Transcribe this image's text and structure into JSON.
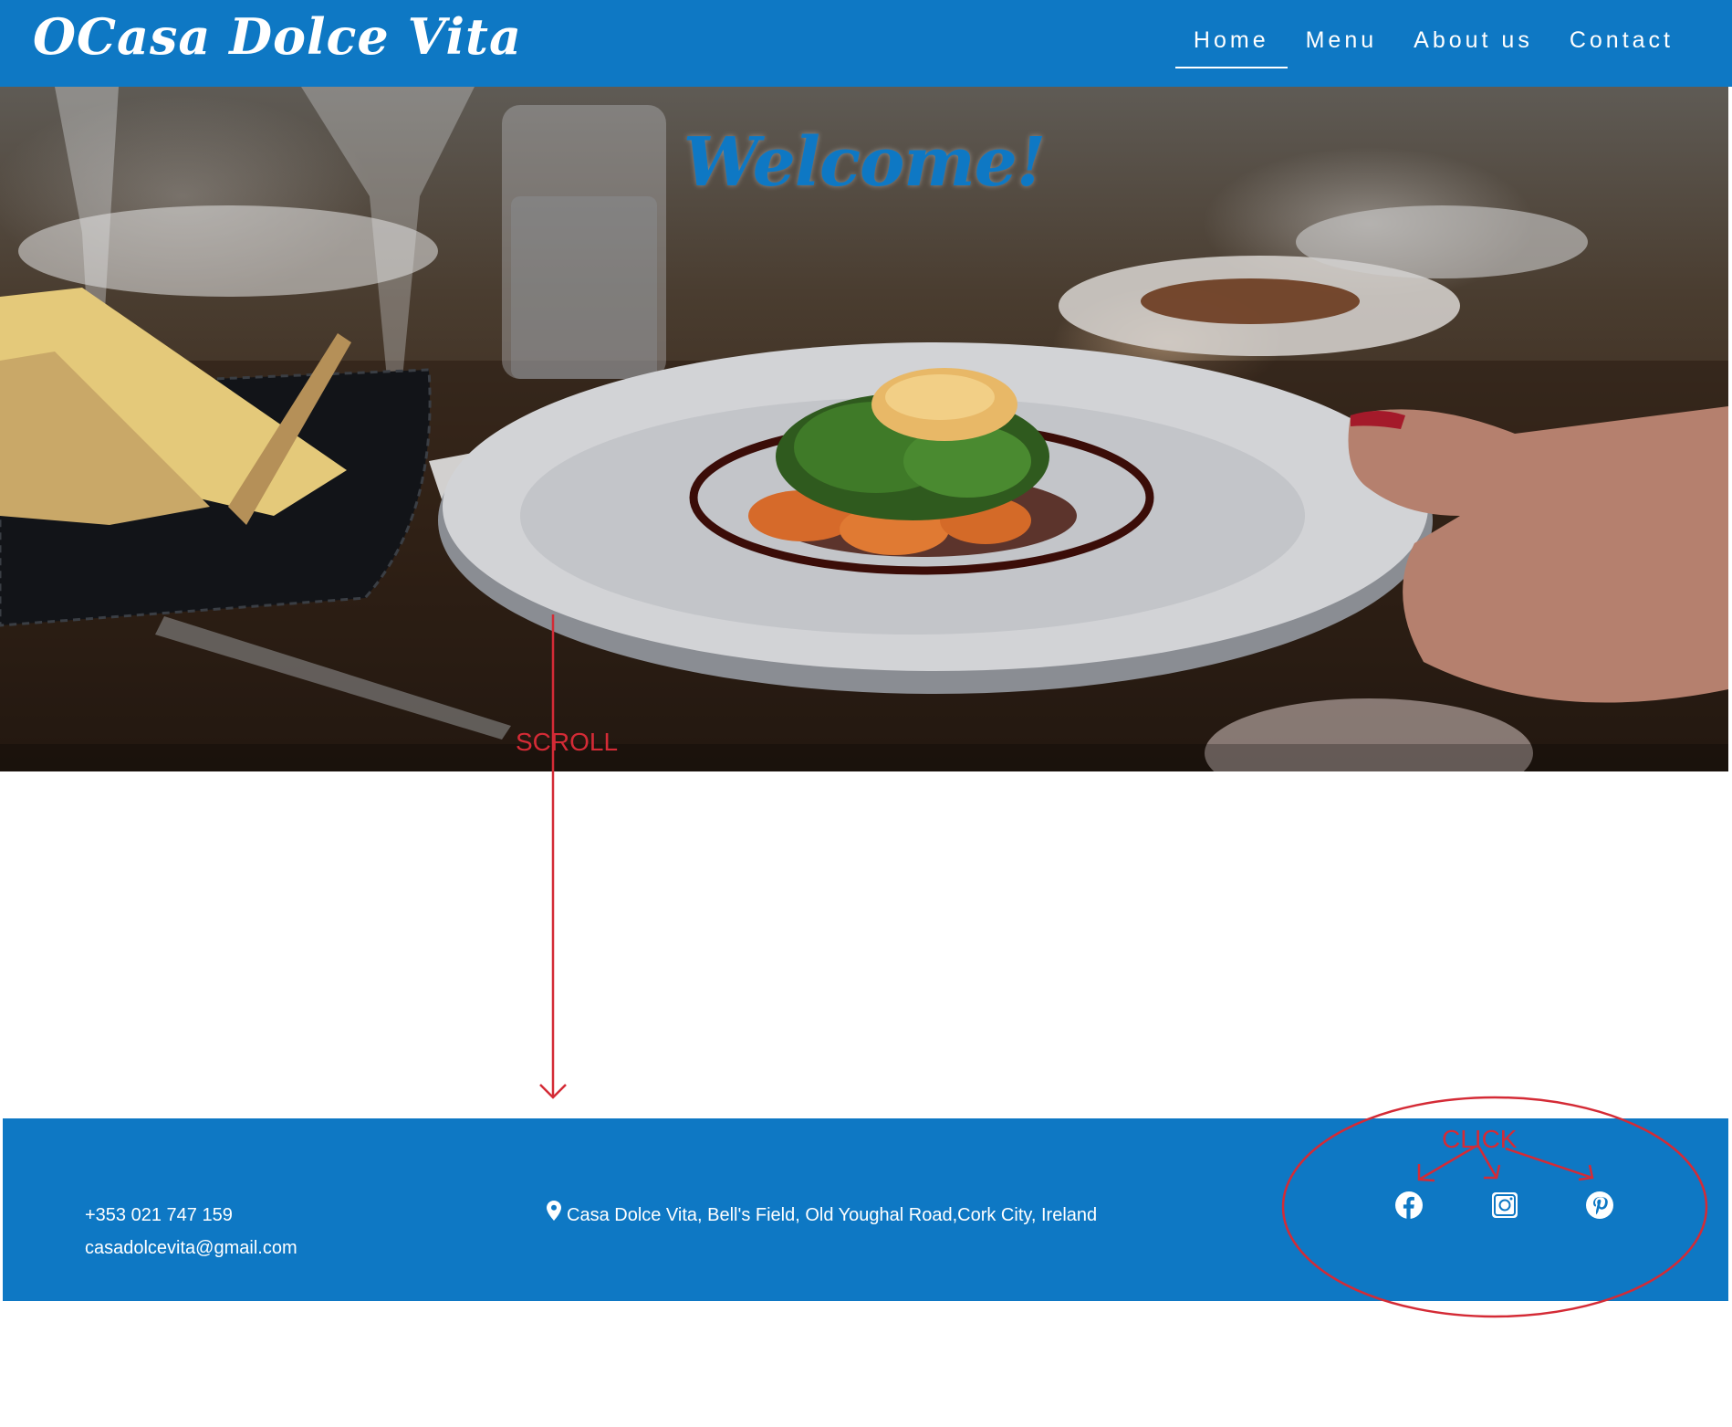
{
  "header": {
    "logo": "OCasa Dolce Vita",
    "nav": [
      {
        "label": "Home",
        "active": true
      },
      {
        "label": "Menu",
        "active": false
      },
      {
        "label": "About us",
        "active": false
      },
      {
        "label": "Contact",
        "active": false
      }
    ]
  },
  "hero": {
    "welcome": "Welcome!"
  },
  "annotations": {
    "scroll": "SCROLL",
    "click": "CLICK"
  },
  "footer": {
    "phone": "+353 021 747 159",
    "email": "casadolcevita@gmail.com",
    "address": "Casa Dolce Vita, Bell's Field, Old Youghal Road,Cork City, Ireland",
    "social": [
      "facebook-icon",
      "instagram-icon",
      "pinterest-icon"
    ]
  },
  "colors": {
    "brand_blue": "#0e78c4",
    "annotation_red": "#d42b36",
    "white": "#ffffff"
  }
}
